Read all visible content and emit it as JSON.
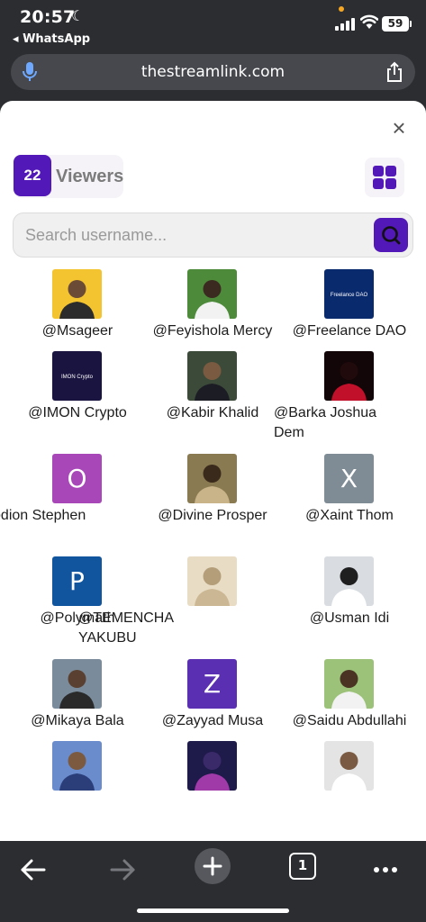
{
  "status": {
    "time": "20:57",
    "source_app": "WhatsApp",
    "battery": "59"
  },
  "browser": {
    "url": "thestreamlink.com",
    "tab_count": "1"
  },
  "viewers": {
    "count": "22",
    "label": "Viewers"
  },
  "search": {
    "placeholder": "Search username..."
  },
  "colors": {
    "accent": "#5218b8"
  },
  "users": [
    {
      "name": "@Msageer",
      "avatar": "photo"
    },
    {
      "name": "@Feyishola Mercy",
      "avatar": "photo"
    },
    {
      "name": "@Freelance DAO",
      "avatar": "logo",
      "logo_text": "Freelance DAO"
    },
    {
      "name": "@IMON Crypto",
      "avatar": "logo",
      "logo_text": "IMON Crypto"
    },
    {
      "name": "@Kabir Khalid",
      "avatar": "photo"
    },
    {
      "name": "@Barka Joshua Dem",
      "avatar": "photo"
    },
    {
      "name": "@Omodion Stephen",
      "avatar": "letter",
      "letter": "O",
      "color": "#a847b8"
    },
    {
      "name": "@Divine Prosper",
      "avatar": "photo"
    },
    {
      "name": "@Xaint Thom",
      "avatar": "letter",
      "letter": "X",
      "color": "#7f8c96"
    },
    {
      "name": "@Polymath",
      "avatar": "letter",
      "letter": "P",
      "color": "#11559e"
    },
    {
      "name": "@TEMENCHA YAKUBU",
      "avatar": "photo"
    },
    {
      "name": "@Usman Idi",
      "avatar": "photo"
    },
    {
      "name": "@Mikaya Bala",
      "avatar": "photo"
    },
    {
      "name": "@Zayyad Musa",
      "avatar": "letter",
      "letter": "Z",
      "color": "#5a2fb1"
    },
    {
      "name": "@Saidu Abdullahi",
      "avatar": "photo"
    },
    {
      "name": "",
      "avatar": "photo"
    },
    {
      "name": "",
      "avatar": "photo"
    },
    {
      "name": "",
      "avatar": "photo"
    }
  ]
}
